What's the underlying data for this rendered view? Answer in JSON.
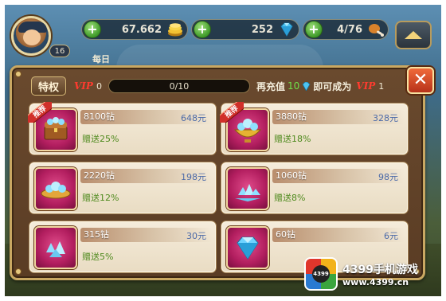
{
  "hud": {
    "level": "16",
    "gold": "67.662",
    "gems": "252",
    "stamina": "4/76",
    "daily_label": "每日"
  },
  "panel": {
    "privilege_label": "特权",
    "current_vip_tag": "VIP",
    "current_vip_level": "0",
    "progress_text": "0/10",
    "progress_fraction": 0.0,
    "recharge_label": "再充值",
    "recharge_amount": "10",
    "become_label": "即可成为",
    "next_vip_tag": "VIP",
    "next_vip_level": "1"
  },
  "offers": [
    {
      "amount": "8100钻",
      "price": "648元",
      "bonus": "赠送25%",
      "ribbon": "推荐",
      "icon": "treasure-chest-icon"
    },
    {
      "amount": "3880钻",
      "price": "328元",
      "bonus": "赠送18%",
      "ribbon": "推荐",
      "icon": "gem-bowl-icon"
    },
    {
      "amount": "2220钻",
      "price": "198元",
      "bonus": "赠送12%",
      "ribbon": "",
      "icon": "gem-dish-icon"
    },
    {
      "amount": "1060钻",
      "price": "98元",
      "bonus": "赠送8%",
      "ribbon": "",
      "icon": "gem-pile-icon"
    },
    {
      "amount": "315钻",
      "price": "30元",
      "bonus": "赠送5%",
      "ribbon": "",
      "icon": "gem-cluster-icon"
    },
    {
      "amount": "60钻",
      "price": "6元",
      "bonus": "",
      "ribbon": "",
      "icon": "single-gem-icon"
    }
  ],
  "watermark": {
    "logo_text": "4399",
    "title": "4399手机游戏",
    "url": "www.4399.cn"
  },
  "colors": {
    "vip_red": "#ff3b2f",
    "bonus_green": "#4f8a1e",
    "price_blue": "#4c6aa8",
    "frame_gold": "#c9a862"
  }
}
